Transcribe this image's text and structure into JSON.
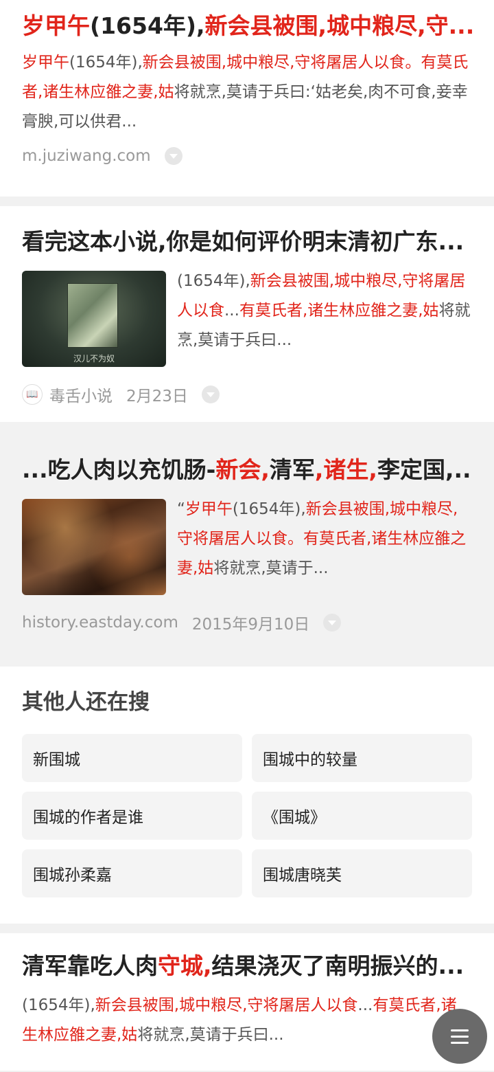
{
  "result1": {
    "title_parts": [
      {
        "t": "岁甲午",
        "hl": true
      },
      {
        "t": "(1654年),",
        "hl": false
      },
      {
        "t": "新会县被围,城中粮尽,守...",
        "hl": true
      }
    ],
    "snippet_parts": [
      {
        "t": "岁甲午",
        "hl": true
      },
      {
        "t": "(1654年),",
        "hl": false
      },
      {
        "t": "新会县被围,城中粮尽,守将屠居人以食。有莫氏者,诸生林应雒之妻,姑",
        "hl": true
      },
      {
        "t": "将就烹,莫请于兵曰:‘姑老矣,肉不可食,妾幸膏腴,可以供君...",
        "hl": false
      }
    ],
    "source": "m.juziwang.com"
  },
  "result2": {
    "title": "看完这本小说,你是如何评价明末清初广东...",
    "thumb_caption": "汉儿不为奴",
    "snippet_parts": [
      {
        "t": "(1654年),",
        "hl": false
      },
      {
        "t": "新会县被围,城中粮尽,守将屠居人以食",
        "hl": true
      },
      {
        "t": "...",
        "hl": false
      },
      {
        "t": "有莫氏者,诸生林应雒之妻,姑",
        "hl": true
      },
      {
        "t": "将就烹,莫请于兵曰...",
        "hl": false
      }
    ],
    "source": "毒舌小说",
    "date": "2月23日"
  },
  "result3": {
    "title_parts": [
      {
        "t": "...吃人肉以充饥肠-",
        "hl": false
      },
      {
        "t": "新会,",
        "hl": true
      },
      {
        "t": "清军",
        "hl": false
      },
      {
        "t": ",诸生,",
        "hl": true
      },
      {
        "t": "李定国,...",
        "hl": false
      }
    ],
    "snippet_parts": [
      {
        "t": "“",
        "hl": false
      },
      {
        "t": "岁甲午",
        "hl": true
      },
      {
        "t": "(1654年),",
        "hl": false
      },
      {
        "t": "新会县被围,城中粮尽,守将屠居人以食。有莫氏者,诸生林应雒之妻,姑",
        "hl": true
      },
      {
        "t": "将就烹,莫请于...",
        "hl": false
      }
    ],
    "source": "history.eastday.com",
    "date": "2015年9月10日"
  },
  "related": {
    "title": "其他人还在搜",
    "items": [
      "新围城",
      "围城中的较量",
      "围城的作者是谁",
      "《围城》",
      "围城孙柔嘉",
      "围城唐晓芙"
    ]
  },
  "result4": {
    "title_parts": [
      {
        "t": "清军靠吃人肉",
        "hl": false
      },
      {
        "t": "守城,",
        "hl": true
      },
      {
        "t": "结果浇灭了南明振兴的...",
        "hl": false
      }
    ],
    "snippet_parts": [
      {
        "t": "(1654年),",
        "hl": false
      },
      {
        "t": "新会县被围,城中粮尽,守将屠居人以食",
        "hl": true
      },
      {
        "t": "...",
        "hl": false
      },
      {
        "t": "有莫氏者,诸生林应雒之妻,姑",
        "hl": true
      },
      {
        "t": "将就烹,莫请于兵曰...",
        "hl": false
      }
    ]
  },
  "colors": {
    "highlight": "#e1251b",
    "text": "#222222",
    "meta": "#999999"
  },
  "icons": {
    "menu_fab": "menu-icon",
    "expand": "chevron-down-icon",
    "book": "book-icon"
  }
}
